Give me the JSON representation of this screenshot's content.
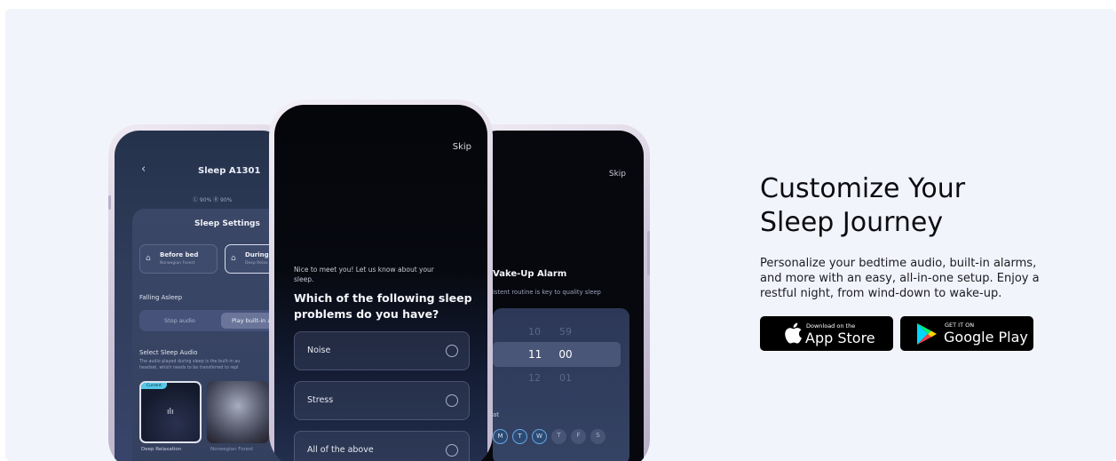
{
  "left_phone": {
    "back": "‹",
    "title": "Sleep A1301",
    "stats": "Ⓛ 90%  Ⓡ 90%",
    "panel_title": "Sleep Settings",
    "option1_name": "Before bed",
    "option1_sub": "Norwegian Forest",
    "option2_name": "During s",
    "option2_sub": "Deep Relax",
    "falling_asleep": "Falling Asleep",
    "segment_left": "Stop audio",
    "segment_right": "Play built-in a",
    "select_audio": "Select Sleep Audio",
    "desc_line1": "The audio played during sleep is the built-in au",
    "desc_line2": "headset, which needs to be transferred to repl",
    "current_badge": "Current",
    "caption1": "Deep Relaxation",
    "caption2": "Norwegian Forest"
  },
  "center_phone": {
    "skip": "Skip",
    "intro_line1": "Nice to meet you! Let us know about your",
    "intro_line2": "sleep.",
    "question_line1": "Which of the following sleep",
    "question_line2": "problems do you have?",
    "options": [
      "Noise",
      "Stress",
      "All of the above"
    ]
  },
  "right_phone": {
    "skip": "Skip",
    "title": "Vake-Up Alarm",
    "subtitle": "istent routine is key to quality sleep",
    "time_rows": [
      {
        "hour": "10",
        "minute": "59"
      },
      {
        "hour": "11",
        "minute": "00"
      },
      {
        "hour": "12",
        "minute": "01"
      }
    ],
    "repeat_label": "at",
    "days": [
      "M",
      "T",
      "W",
      "T",
      "F",
      "S"
    ]
  },
  "hero": {
    "headline_line1": "Customize Your",
    "headline_line2": "Sleep Journey",
    "desc_line1": "Personalize your bedtime audio, built-in alarms,",
    "desc_line2": "and more with an easy, all-in-one setup. Enjoy a",
    "desc_line3": "restful night, from wind-down to wake-up."
  },
  "stores": {
    "apple_small": "Download on the",
    "apple_big": "App Store",
    "google_small": "GET IT ON",
    "google_big": "Google Play"
  },
  "icons": {
    "apple": "apple-logo-icon",
    "google_play": "google-play-logo-icon",
    "bed": "bed-icon",
    "radio": "radio-circle-icon"
  },
  "colors": {
    "background": "#f2f4fb",
    "text_dark": "#0c0c10",
    "button_bg": "#000000",
    "accent_current": "#56c8e8"
  }
}
